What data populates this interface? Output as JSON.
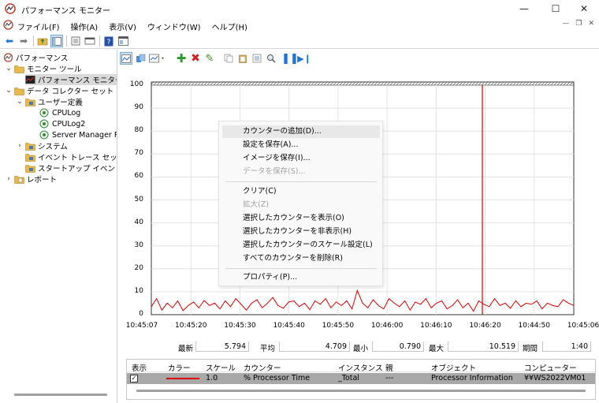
{
  "window": {
    "title": "パフォーマンス モニター"
  },
  "menubar": {
    "items": [
      "ファイル(F)",
      "操作(A)",
      "表示(V)",
      "ウィンドウ(W)",
      "ヘルプ(H)"
    ]
  },
  "tree": {
    "root": "パフォーマンス",
    "monitoring_tools": "モニター ツール",
    "perf_monitor": "パフォーマンス モニター",
    "data_collector_sets": "データ コレクター セット",
    "user_defined": "ユーザー定義",
    "cpulog": "CPULog",
    "cpulog2": "CPULog2",
    "server_manager": "Server Manager Per",
    "system": "システム",
    "event_trace": "イベント トレース セッション",
    "startup_event_trace": "スタートアップ イベント トレ",
    "reports": "レポート"
  },
  "graph": {
    "y_ticks": [
      "100",
      "90",
      "80",
      "70",
      "60",
      "50",
      "40",
      "30",
      "20",
      "10",
      "0"
    ],
    "x_ticks": [
      "10:45:07",
      "10:45:20",
      "10:45:30",
      "10:45:40",
      "10:45:50",
      "10:46:00",
      "10:46:10",
      "10:46:20",
      "10:44:50",
      "10:45:06"
    ],
    "line_color": "#e00000",
    "cursor_color": "#cc0000",
    "values": [
      3.5,
      7,
      2,
      5,
      3,
      6,
      1.8,
      4,
      5.5,
      3,
      6.2,
      4,
      5,
      2.5,
      6,
      3.5,
      7,
      4.5,
      2,
      5,
      6.5,
      3,
      5,
      7.5,
      4,
      2.8,
      5.5,
      6,
      3.5,
      5,
      2.2,
      6,
      4.5,
      7,
      3,
      5.5,
      4,
      6,
      2.5,
      10.5,
      5,
      3,
      6.5,
      4,
      2.5,
      7,
      5,
      3.5,
      6,
      2,
      5.5,
      4.5,
      7,
      3,
      5,
      6,
      2.5,
      4,
      6.5,
      3,
      5,
      1.5,
      6,
      4.5,
      3.5,
      7,
      4,
      5,
      2.8,
      6,
      3.5,
      5,
      4.5,
      6,
      2.5,
      5,
      4,
      3.5,
      6.5,
      5,
      4
    ]
  },
  "stats": {
    "last_label": "最新",
    "last_value": "5.794",
    "avg_label": "平均",
    "avg_value": "4.709",
    "min_label": "最小",
    "min_value": "0.790",
    "max_label": "最大",
    "max_value": "10.519",
    "duration_label": "期間",
    "duration_value": "1:40"
  },
  "table": {
    "headers": [
      "表示",
      "カラー",
      "スケール",
      "カウンター",
      "インスタンス",
      "親",
      "オブジェクト",
      "コンピューター"
    ],
    "row": {
      "check": "✓",
      "scale": "1.0",
      "counter": "% Processor Time",
      "instance": "_Total",
      "parent": "---",
      "object": "Processor Information",
      "computer": "¥¥WS2022VM01"
    }
  },
  "context_menu": {
    "add_counters": "カウンターの追加(D)...",
    "save_settings": "設定を保存(A)...",
    "save_image": "イメージを保存(I)...",
    "save_data": "データを保存(S)...",
    "clear": "クリア(C)",
    "zoom": "拡大(Z)",
    "show_selected": "選択したカウンターを表示(O)",
    "hide_selected": "選択したカウンターを非表示(H)",
    "scale_selected": "選択したカウンターのスケール設定(L)",
    "remove_all": "すべてのカウンターを削除(R)",
    "properties": "プロパティ(P)..."
  }
}
